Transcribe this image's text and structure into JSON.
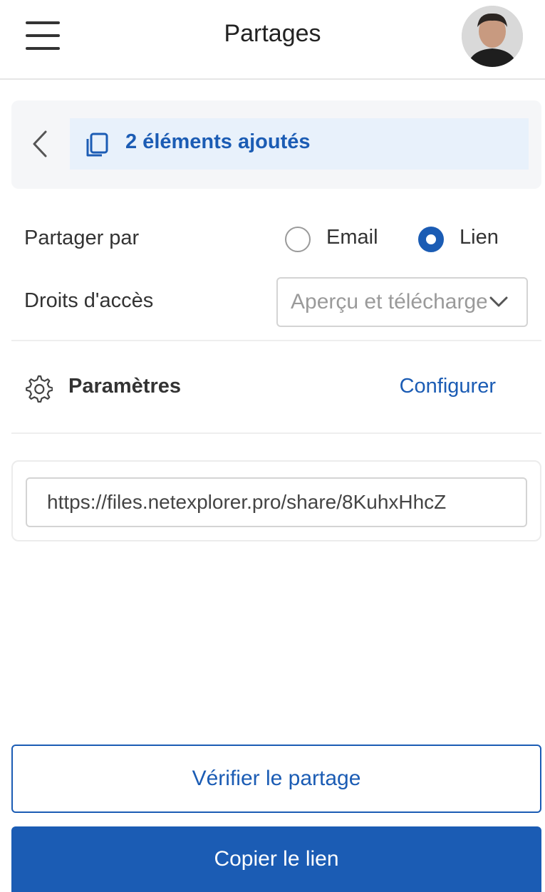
{
  "header": {
    "title": "Partages"
  },
  "breadcrumb": {
    "selection_label": "2 éléments ajoutés"
  },
  "share_by": {
    "label": "Partager par",
    "options": [
      {
        "label": "Email",
        "selected": false
      },
      {
        "label": "Lien",
        "selected": true
      }
    ]
  },
  "access_rights": {
    "label": "Droits d'accès",
    "value": "Aperçu et téléchargement"
  },
  "settings": {
    "label": "Paramètres",
    "configure_label": "Configurer"
  },
  "share_link": {
    "value": "https://files.netexplorer.pro/share/8KuhxHhcZ"
  },
  "actions": {
    "verify_label": "Vérifier le partage",
    "copy_label": "Copier le lien"
  },
  "colors": {
    "accent": "#1b5cb4",
    "chip_background": "#e8f1fb"
  },
  "icons": [
    "menu-icon",
    "avatar",
    "chevron-left-icon",
    "copy-icon",
    "gear-icon",
    "chevron-down-icon"
  ]
}
